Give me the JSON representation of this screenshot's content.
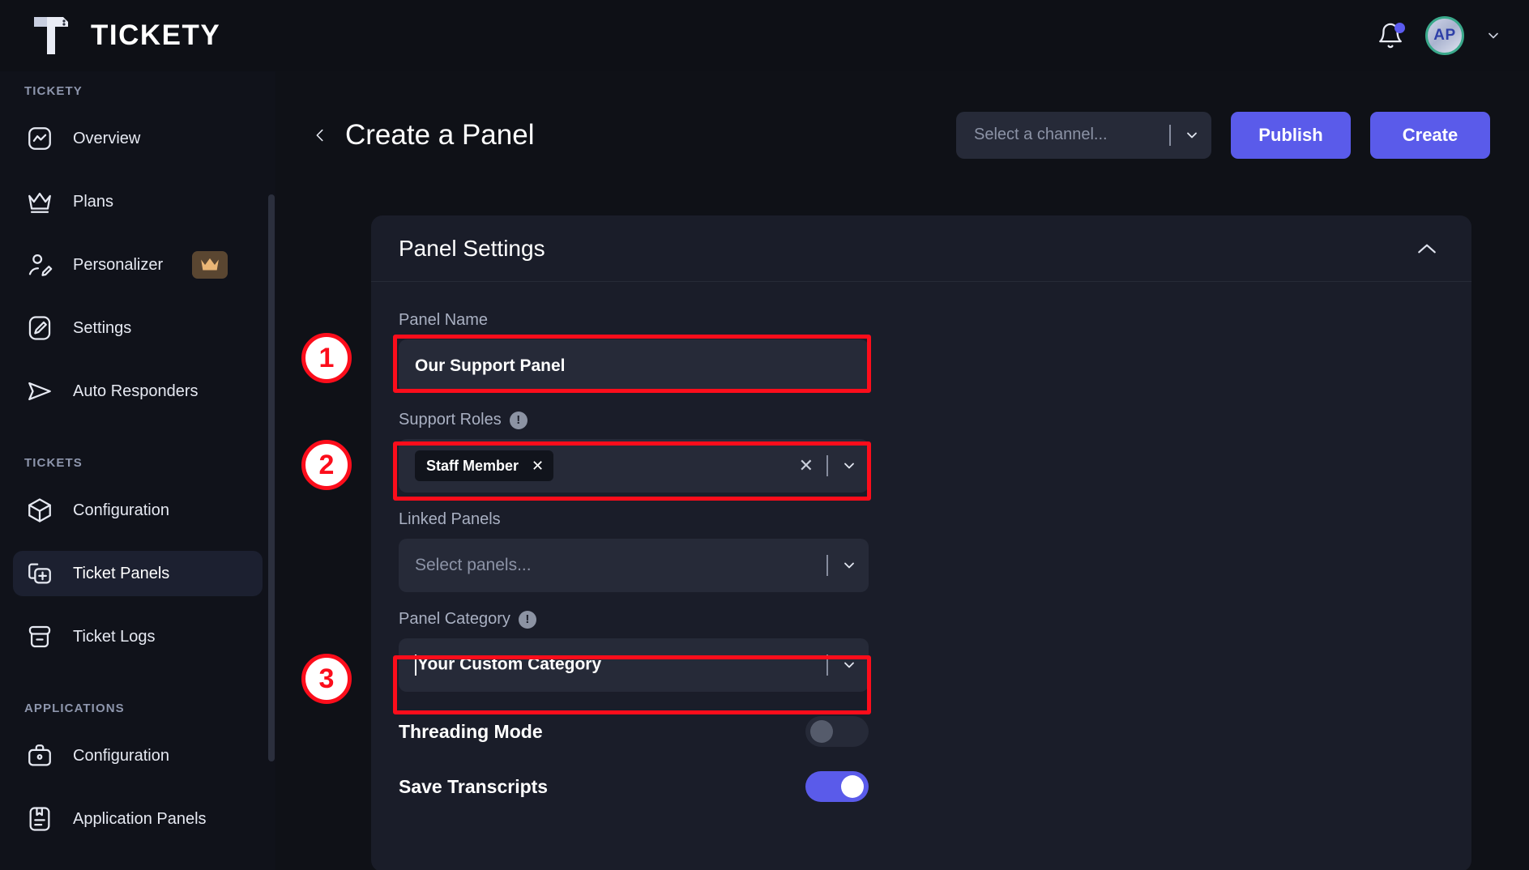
{
  "topbar": {
    "brand_name": "TICKETY",
    "logo_icon": "hammer-ticket-logo",
    "bell_icon": "notification-bell-icon",
    "avatar_initials": "AP",
    "account_chevron": "chevron-down-icon"
  },
  "sidebar": {
    "sections": [
      {
        "title": "TICKETY",
        "items": [
          {
            "label": "Overview",
            "icon": "activity-square-icon",
            "active": false,
            "badge": null
          },
          {
            "label": "Plans",
            "icon": "crown-icon",
            "active": false,
            "badge": null
          },
          {
            "label": "Personalizer",
            "icon": "user-edit-icon",
            "active": false,
            "badge": "crown-badge"
          },
          {
            "label": "Settings",
            "icon": "pencil-square-icon",
            "active": false,
            "badge": null
          },
          {
            "label": "Auto Responders",
            "icon": "send-icon",
            "active": false,
            "badge": null
          }
        ]
      },
      {
        "title": "TICKETS",
        "items": [
          {
            "label": "Configuration",
            "icon": "cube-icon",
            "active": false,
            "badge": null
          },
          {
            "label": "Ticket Panels",
            "icon": "panel-plus-icon",
            "active": true,
            "badge": null
          },
          {
            "label": "Ticket Logs",
            "icon": "archive-box-icon",
            "active": false,
            "badge": null
          }
        ]
      },
      {
        "title": "APPLICATIONS",
        "items": [
          {
            "label": "Configuration",
            "icon": "briefcase-icon",
            "active": false,
            "badge": null
          },
          {
            "label": "Application Panels",
            "icon": "document-form-icon",
            "active": false,
            "badge": null
          }
        ]
      }
    ]
  },
  "page": {
    "back_icon": "chevron-left-icon",
    "title": "Create a Panel",
    "channel_select_placeholder": "Select a channel...",
    "channel_select_chevron": "chevron-down-icon",
    "publish_label": "Publish",
    "create_label": "Create"
  },
  "card": {
    "title": "Panel Settings",
    "collapse_icon": "chevron-up-icon",
    "fields": {
      "panel_name": {
        "label": "Panel Name",
        "value": "Our Support Panel",
        "has_info": false
      },
      "support_roles": {
        "label": "Support Roles",
        "has_info": true,
        "info_icon": "exclamation-circle-icon",
        "chips": [
          {
            "label": "Staff Member",
            "remove_icon": "close-icon"
          }
        ],
        "clear_icon": "close-icon",
        "chevron": "chevron-down-icon"
      },
      "linked_panels": {
        "label": "Linked Panels",
        "placeholder": "Select panels...",
        "has_info": false,
        "chevron": "chevron-down-icon"
      },
      "panel_category": {
        "label": "Panel Category",
        "has_info": true,
        "info_icon": "exclamation-circle-icon",
        "value": "Your Custom Category",
        "chevron": "chevron-down-icon"
      }
    },
    "toggles": [
      {
        "label": "Threading Mode",
        "state": "off"
      },
      {
        "label": "Save Transcripts",
        "state": "on"
      }
    ]
  },
  "annotations": [
    {
      "number": "1",
      "target": "panel-name-input"
    },
    {
      "number": "2",
      "target": "support-roles-input"
    },
    {
      "number": "3",
      "target": "panel-category-input"
    }
  ],
  "colors": {
    "accent": "#5a5bea",
    "annotation_red": "#fc0d1b",
    "page_bg": "#0f1117",
    "card_bg": "#1a1d29",
    "input_bg": "#262a38",
    "crown_gold": "#eab676"
  }
}
